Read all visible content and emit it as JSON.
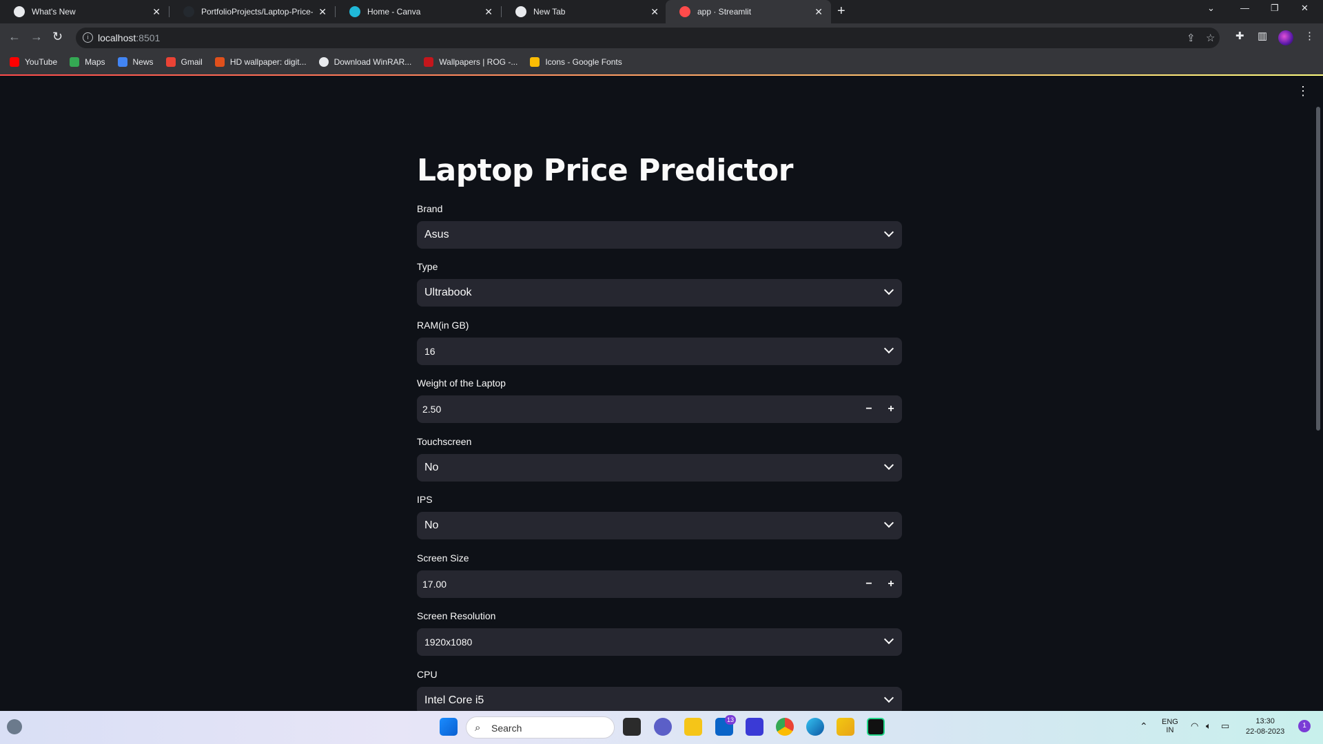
{
  "browser": {
    "tabs": [
      {
        "title": "What's New",
        "x": 0
      },
      {
        "title": "PortfolioProjects/Laptop-Price-Pr",
        "x": 0
      },
      {
        "title": "Home - Canva",
        "x": 0
      },
      {
        "title": "New Tab",
        "x": 0
      },
      {
        "title": "app · Streamlit",
        "x": 0
      }
    ],
    "url_host": "localhost",
    "url_port": ":8501",
    "bookmarks": [
      "YouTube",
      "Maps",
      "News",
      "Gmail",
      "HD wallpaper: digit...",
      "Download WinRAR...",
      "Wallpapers | ROG -...",
      "Icons - Google Fonts"
    ]
  },
  "app": {
    "title": "Laptop Price Predictor",
    "fields": {
      "brand": {
        "label": "Brand",
        "value": "Asus"
      },
      "type": {
        "label": "Type",
        "value": "Ultrabook"
      },
      "ram": {
        "label": "RAM(in GB)",
        "value": "16"
      },
      "weight": {
        "label": "Weight of the Laptop",
        "value": "2.50"
      },
      "touchscreen": {
        "label": "Touchscreen",
        "value": "No"
      },
      "ips": {
        "label": "IPS",
        "value": "No"
      },
      "screen_size": {
        "label": "Screen Size",
        "value": "17.00"
      },
      "resolution": {
        "label": "Screen Resolution",
        "value": "1920x1080"
      },
      "cpu": {
        "label": "CPU",
        "value": "Intel Core i5"
      }
    }
  },
  "taskbar": {
    "search_placeholder": "Search",
    "mail_badge": "13",
    "lang_top": "ENG",
    "lang_bottom": "IN",
    "time": "13:30",
    "date": "22-08-2023",
    "notifications": "1"
  }
}
